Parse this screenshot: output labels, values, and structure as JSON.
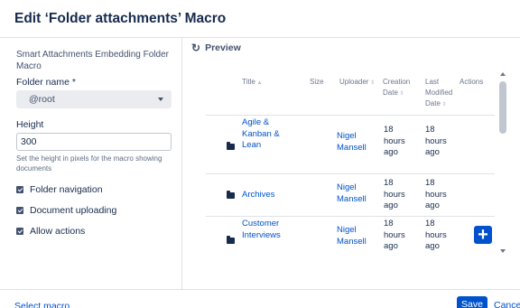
{
  "dialog": {
    "title": "Edit ‘Folder attachments’ Macro"
  },
  "form": {
    "macro_description": "Smart Attachments Embedding Folder Macro",
    "folder_label": "Folder name *",
    "folder_value": "@root",
    "height_label": "Height",
    "height_value": "300",
    "height_help": "Set the height in pixels for the macro showing documents",
    "checkboxes": [
      {
        "label": "Folder navigation",
        "checked": true
      },
      {
        "label": "Document uploading",
        "checked": true
      },
      {
        "label": "Allow actions",
        "checked": true
      }
    ]
  },
  "preview": {
    "heading": "Preview",
    "icon": "refresh-icon",
    "columns": {
      "title": "Title",
      "size": "Size",
      "uploader": "Uploader",
      "creation_1": "Creation",
      "creation_2": "Date",
      "modified_1": "Last",
      "modified_2": "Modified",
      "modified_3": "Date",
      "actions": "Actions"
    },
    "rows": [
      {
        "icon": "folder-icon",
        "title_lines": [
          "Agile &",
          "Kanban &",
          "Lean"
        ],
        "uploader_lines": [
          "Nigel",
          "Mansell"
        ],
        "created_lines": [
          "18",
          "hours",
          "ago"
        ],
        "modified_lines": [
          "18",
          "hours",
          "ago"
        ]
      },
      {
        "icon": "folder-icon",
        "title_lines": [
          "Archives"
        ],
        "uploader_lines": [
          "Nigel",
          "Mansell"
        ],
        "created_lines": [
          "18",
          "hours",
          "ago"
        ],
        "modified_lines": [
          "18",
          "hours",
          "ago"
        ]
      },
      {
        "icon": "folder-icon",
        "title_lines": [
          "Customer",
          "Interviews"
        ],
        "uploader_lines": [
          "Nigel",
          "Mansell"
        ],
        "created_lines": [
          "18",
          "hours",
          "ago"
        ],
        "modified_lines": [
          "18",
          "hours",
          "ago"
        ]
      }
    ],
    "add_button_glyph": "+"
  },
  "footer": {
    "select_macro": "Select macro",
    "save": "Save",
    "cancel": "Cancel"
  },
  "colors": {
    "accent": "#0052cc",
    "text": "#172b4d",
    "muted": "#6b778c",
    "border": "#dfe1e6"
  }
}
